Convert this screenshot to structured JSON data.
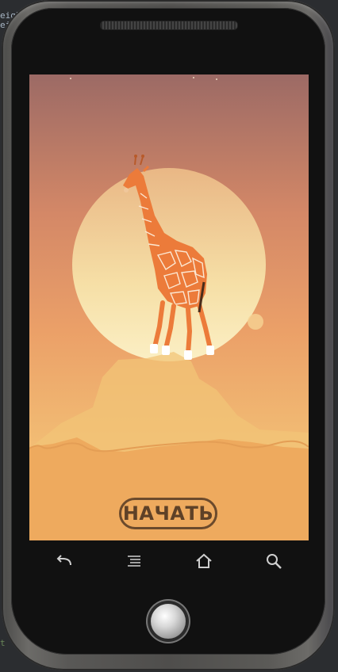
{
  "ide": {
    "top_lines": [
      "eigh",
      "ei"
    ],
    "bottom_line": "t"
  },
  "app": {
    "start_label": "НАЧАТЬ"
  },
  "navbar": {
    "icons": [
      "back-icon",
      "menu-icon",
      "home-icon",
      "search-icon"
    ]
  },
  "colors": {
    "sky_top": "#9c6a65",
    "sky_mid": "#e08f61",
    "sky_low": "#f0b46b",
    "sun": "#f6dba1",
    "ground": "#eaa65c",
    "button_border": "#6b4a2c",
    "giraffe": "#ec7b3a"
  }
}
